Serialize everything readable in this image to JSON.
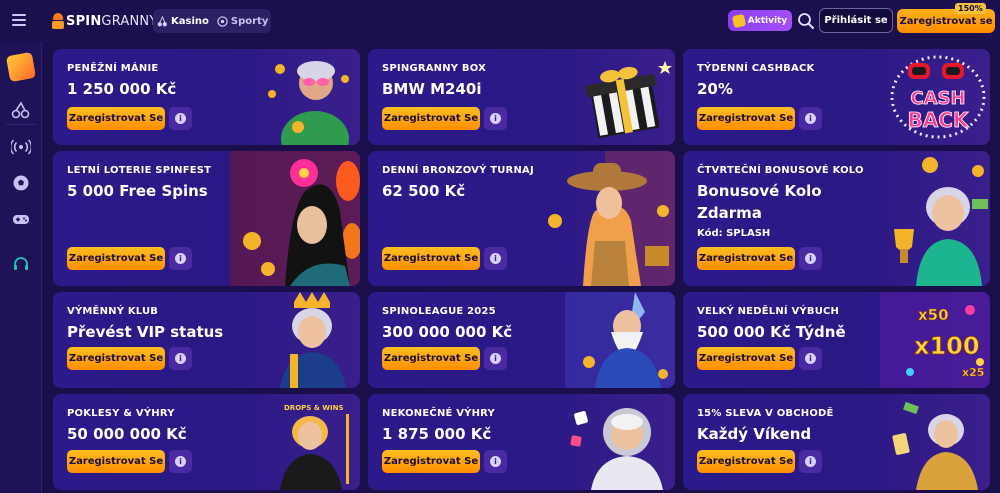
{
  "header": {
    "logo": {
      "spin": "SPIN",
      "granny": "GRANNY"
    },
    "tabs": [
      {
        "label": "Kasino",
        "icon": "cherry-icon"
      },
      {
        "label": "Sporty",
        "icon": "soccer-ball-icon"
      }
    ],
    "aktivity_label": "Aktivity",
    "login_label": "Přihlásit se",
    "register_label": "Zaregistrovat se",
    "bonus_badge": "150%"
  },
  "sidebar": {
    "items": [
      {
        "icon": "promotions-icon"
      },
      {
        "icon": "cherry-icon"
      },
      {
        "icon": "live-icon"
      },
      {
        "icon": "soccer-ball-icon"
      },
      {
        "icon": "gamepad-icon"
      },
      {
        "icon": "support-headset-icon"
      }
    ]
  },
  "promotions": [
    {
      "small": "PENĚŽNÍ MÁNIE",
      "large": "1 250 000 Kč",
      "extra": "",
      "button": "Zaregistrovat Se",
      "art": "granny-sunglasses-coins"
    },
    {
      "small": "SPINGRANNY BOX",
      "large": "BMW M240i",
      "extra": "",
      "button": "Zaregistrovat Se",
      "art": "gift-box"
    },
    {
      "small": "TÝDENNÍ CASHBACK",
      "large": "20%",
      "extra": "",
      "button": "Zaregistrovat Se",
      "art": "cashback-logo"
    },
    {
      "small": "LETNÍ LOTERIE SPINFEST",
      "large": "5 000 Free Spins",
      "extra": "",
      "button": "Zaregistrovat Se",
      "art": "asian-lady-lanterns"
    },
    {
      "small": "DENNÍ BRONZOVÝ TURNAJ",
      "large": "62 500 Kč",
      "extra": "",
      "button": "Zaregistrovat Se",
      "art": "cowgirl"
    },
    {
      "small": "ČTVRTEČNÍ BONUSOVÉ KOLO",
      "large": "Bonusové Kolo Zdarma",
      "extra": "Kód: SPLASH",
      "button": "Zaregistrovat Se",
      "art": "granny-trophy"
    },
    {
      "small": "VÝMĚNNÝ KLUB",
      "large": "Převést VIP status",
      "extra": "",
      "button": "Zaregistrovat Se",
      "art": "queen-granny"
    },
    {
      "small": "SPINOLEAGUE 2025",
      "large": "300 000 000 Kč",
      "extra": "",
      "button": "Zaregistrovat Se",
      "art": "wizard"
    },
    {
      "small": "VELKÝ NEDĚLNÍ VÝBUCH",
      "large": "500 000 Kč Týdně",
      "extra": "",
      "button": "Zaregistrovat Se",
      "art": "multipliers"
    },
    {
      "small": "POKLESY & VÝHRY",
      "large": "50 000 000 Kč",
      "extra": "",
      "button": "Zaregistrovat Se",
      "art": "drops-wins-granny"
    },
    {
      "small": "NEKONEČNÉ VÝHRY",
      "large": "1 875 000 Kč",
      "extra": "",
      "button": "Zaregistrovat Se",
      "art": "astronaut-granny"
    },
    {
      "small": "15% SLEVA V OBCHODĚ",
      "large": "Každý Víkend",
      "extra": "",
      "button": "Zaregistrovat Se",
      "art": "gold-granny-cards"
    }
  ],
  "multipliers": {
    "a": "x50",
    "b": "x100",
    "c": "x25"
  },
  "cashback_art": {
    "line1": "CASH",
    "line2": "BACK"
  },
  "drops_art": "DROPS & WINS",
  "colors": {
    "accent": "#ffa500",
    "background": "#1a0f4a",
    "card": "#2b1a8a"
  }
}
